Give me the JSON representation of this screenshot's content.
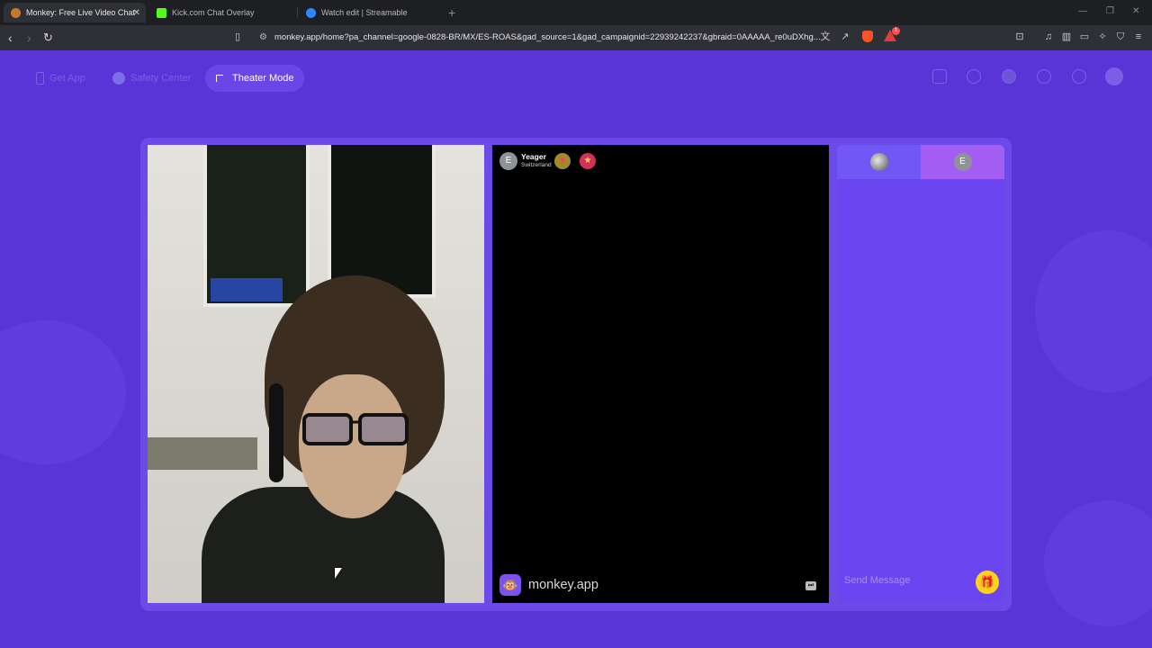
{
  "browser": {
    "tabs": [
      {
        "title": "Monkey: Free Live Video Chat",
        "active": true,
        "favicon_color": "#c9772f"
      },
      {
        "title": "Kick.com Chat Overlay",
        "active": false,
        "favicon_color": "#53fc18"
      },
      {
        "title": "Watch edit | Streamable",
        "active": false,
        "favicon_color": "#2d88ff"
      }
    ],
    "new_tab_label": "+",
    "url": "monkey.app/home?pa_channel=google-0828-BR/MX/ES-ROAS&gad_source=1&gad_campaignid=22939242237&gbraid=0AAAAA_re0uDXhg...",
    "rewards_count": "1"
  },
  "topnav": {
    "get_app": "Get App",
    "safety_center": "Safety Center",
    "theater_mode": "Theater Mode"
  },
  "remote": {
    "avatar_initial": "E",
    "name": "Yeager",
    "country": "Switzerland",
    "brand": "monkey.app"
  },
  "chat": {
    "peer_initial": "E",
    "placeholder": "Send Message"
  },
  "colors": {
    "page_bg": "#5b34d8",
    "panel": "#6b45f0",
    "gift": "#ffd21a"
  }
}
